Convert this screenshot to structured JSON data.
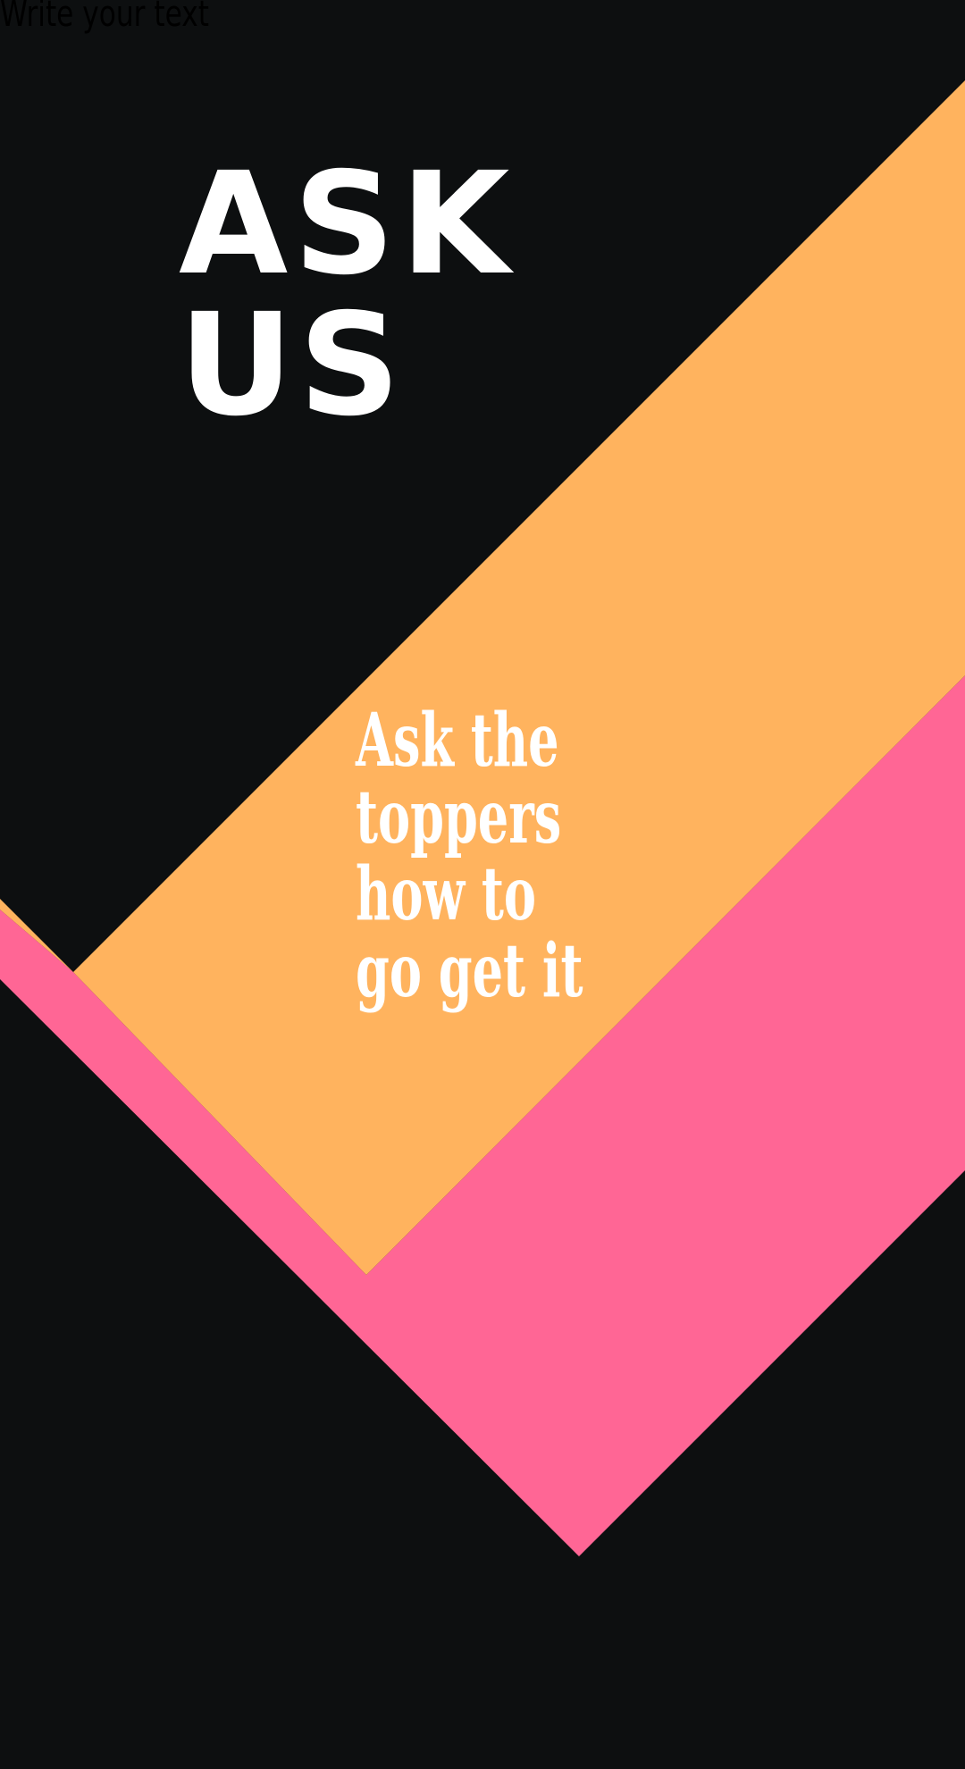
{
  "placeholder_text": "Write your text",
  "headline": {
    "line1": "ASK",
    "line2": "US"
  },
  "tagline": {
    "line1": "Ask the",
    "line2": "toppers",
    "line3": "how to",
    "line4": "go get it"
  },
  "colors": {
    "background": "#0d0f10",
    "orange": "#ffb35e",
    "pink": "#ff6695",
    "text": "#ffffff"
  }
}
